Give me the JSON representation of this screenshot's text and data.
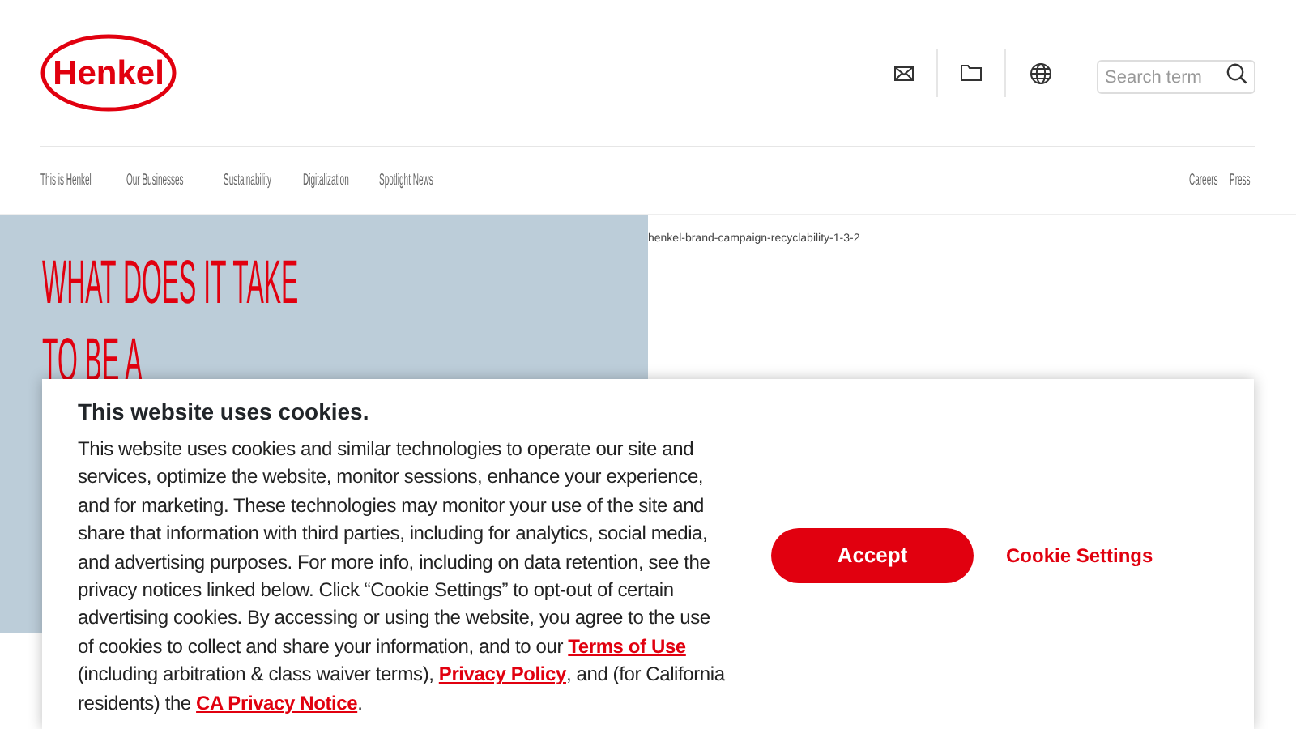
{
  "header": {
    "logo": "Henkel",
    "search": {
      "placeholder": "Search term"
    }
  },
  "nav": {
    "main": [
      "This is Henkel",
      "Our Businesses",
      "Sustainability",
      "Digitalization",
      "Spotlight News"
    ],
    "secondary": [
      "Careers",
      "Press"
    ]
  },
  "hero": {
    "headline": [
      "WHAT DOES IT TAKE",
      "TO BE A"
    ],
    "image_alt": "henkel-brand-campaign-recyclability-1-3-2"
  },
  "cookie_banner": {
    "title": "This website uses cookies.",
    "text": "This website uses cookies and similar technologies to operate our site and services, optimize the website, monitor sessions, enhance your experience, and for marketing. These technologies may monitor your use of the site and share that information with third parties, including for analytics, social media, and advertising purposes. For more info, including on data retention, see the privacy notices linked below. Click “Cookie Settings” to opt-out of certain advertising cookies. By accessing or using the website, you agree to the use of cookies to collect and share your information, and to our ",
    "links": [
      {
        "label": "Terms of Use",
        "after": " (including arbitration & class waiver terms), "
      },
      {
        "label": "Privacy Policy",
        "after": ", and (for California residents) the "
      },
      {
        "label": "CA Privacy Notice",
        "after": "."
      }
    ],
    "accept": "Accept",
    "settings": "Cookie Settings"
  }
}
